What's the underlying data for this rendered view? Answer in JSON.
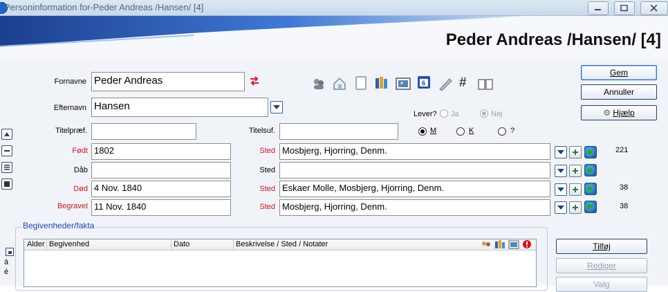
{
  "window": {
    "title": "Personinformation for-Peder Andreas /Hansen/ [4]"
  },
  "header": {
    "title": "Peder Andreas /Hansen/ [4]"
  },
  "form": {
    "fornavne_label": "Fornavne",
    "fornavne_value": "Peder Andreas",
    "efternavn_label": "Efternavn",
    "efternavn_value": "Hansen",
    "titelpraef_label": "Titelpræf.",
    "titelpraef_value": "",
    "titelsuf_label": "Titelsuf.",
    "titelsuf_value": "",
    "lever_label": "Lever?",
    "lever_ja": "Ja",
    "lever_nej": "Nej",
    "lever_selected": "Nej",
    "sex_m": "M",
    "sex_k": "K",
    "sex_unknown": "?",
    "sex_selected": "M"
  },
  "events": [
    {
      "label": "Født",
      "label_color": "#d8101a",
      "date": "1802",
      "sted_label": "Sted",
      "sted_color": "#d8101a",
      "place": "Mosbjerg, Hjorring, Denm.",
      "count": "221"
    },
    {
      "label": "Dåb",
      "label_color": "#000000",
      "date": "",
      "sted_label": "Sted",
      "sted_color": "#000000",
      "place": "",
      "count": ""
    },
    {
      "label": "Død",
      "label_color": "#d8101a",
      "date": "4 Nov. 1840",
      "sted_label": "Sted",
      "sted_color": "#d8101a",
      "place": "Eskaer Molle, Mosbjerg, Hjorring, Denm.",
      "count": "38"
    },
    {
      "label": "Begravet",
      "label_color": "#d8101a",
      "date": "11 Nov. 1840",
      "sted_label": "Sted",
      "sted_color": "#d8101a",
      "place": "Mosbjerg, Hjorring, Denm.",
      "count": "38"
    }
  ],
  "buttons": {
    "gem": "Gem",
    "annuller": "Annuller",
    "hjaelp": "Hjælp",
    "tilfoj": "Tilføj",
    "rediger": "Rediger",
    "valg": "Valg"
  },
  "toolbar_icons": [
    "people-icon",
    "house-icon",
    "notepad-icon",
    "books-icon",
    "photo-icon",
    "calendar-icon",
    "pen-icon",
    "hash-icon",
    "open-book-icon"
  ],
  "event_section": {
    "legend": "Begivenheder/fakta",
    "columns": [
      "Alder",
      "Begivenhed",
      "Dato",
      "Beskrivelse / Sted / Notater"
    ]
  },
  "colors": {
    "accent_red": "#d8101a",
    "legend_blue": "#1b3fc1",
    "header_blue": "#1f5fd1"
  }
}
